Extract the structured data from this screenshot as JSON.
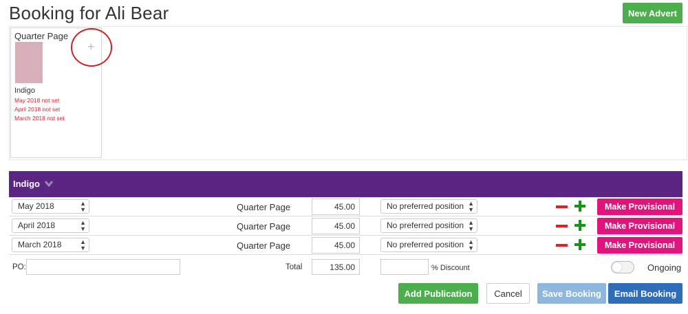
{
  "page": {
    "title": "Booking for Ali Bear",
    "new_advert_label": "New Advert"
  },
  "advert_card": {
    "size": "Quarter Page",
    "plus_glyph": "+",
    "publication": "Indigo",
    "status_lines": [
      "May 2018 not set",
      "April 2018 not set",
      "March 2018 not set"
    ],
    "thumb_color": "#d7afb9"
  },
  "publication": {
    "name": "Indigo",
    "header_color": "#5b2583",
    "rows": [
      {
        "month": "May 2018",
        "size": "Quarter Page",
        "price": "45.00",
        "position": "No preferred position",
        "action": "Make Provisional"
      },
      {
        "month": "April 2018",
        "size": "Quarter Page",
        "price": "45.00",
        "position": "No preferred position",
        "action": "Make Provisional"
      },
      {
        "month": "March 2018",
        "size": "Quarter Page",
        "price": "45.00",
        "position": "No preferred position",
        "action": "Make Provisional"
      }
    ],
    "po_label": "PO:",
    "po_value": "",
    "total_label": "Total",
    "total_value": "135.00",
    "discount_value": "",
    "discount_label": "% Discount",
    "ongoing_label": "Ongoing",
    "ongoing_on": false
  },
  "actions": {
    "add_publication": "Add Publication",
    "cancel": "Cancel",
    "save_booking": "Save Booking",
    "email_booking": "Email Booking"
  },
  "icons": {
    "minus": "minus-icon",
    "plus": "plus-icon",
    "chevron": "chevron-down-icon",
    "select_arrows": "select-arrows-icon"
  }
}
